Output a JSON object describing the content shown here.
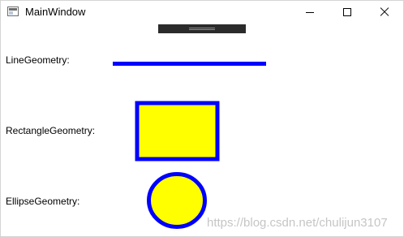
{
  "window": {
    "title": "MainWindow"
  },
  "labels": {
    "line": "LineGeometry:",
    "rectangle": "RectangleGeometry:",
    "ellipse": "EllipseGeometry:"
  },
  "shapes": {
    "stroke_color": "#0000FF",
    "fill_color": "#FFFF00"
  },
  "watermark": "https://blog.csdn.net/chulijun3107"
}
